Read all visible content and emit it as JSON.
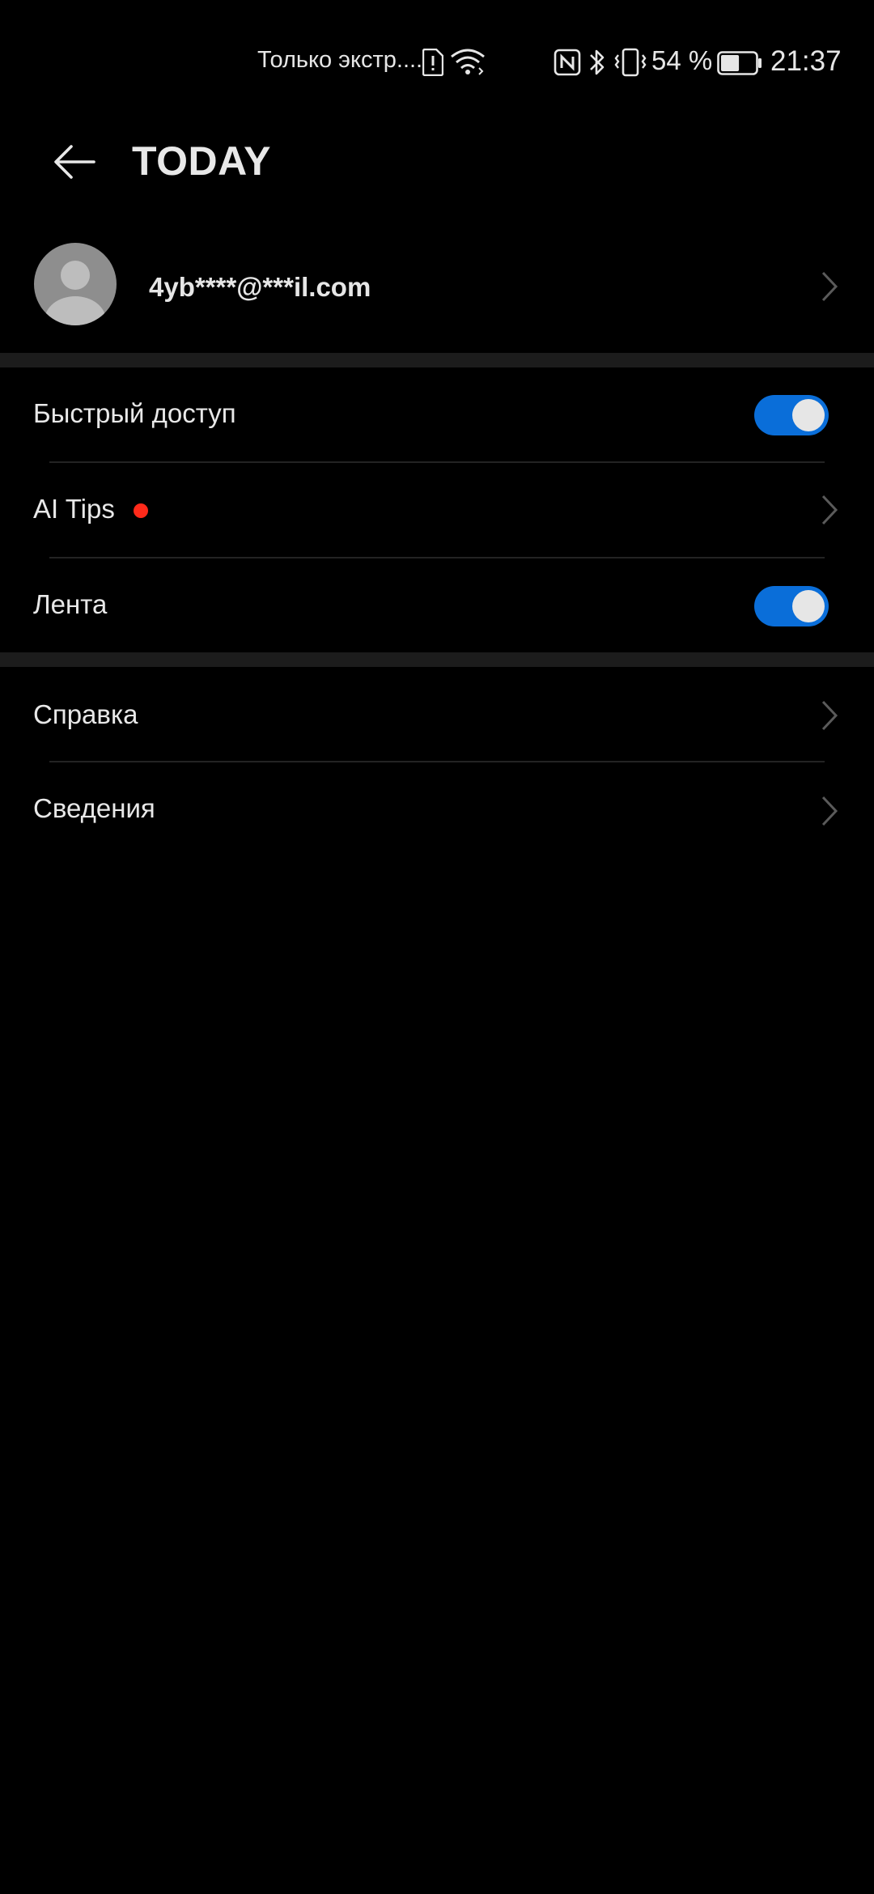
{
  "status_bar": {
    "carrier_text": "Только экстр....",
    "battery_percent": "54 %",
    "time": "21:37",
    "battery_level": 0.54,
    "icons": [
      "sim-alert-icon",
      "wifi-icon",
      "nfc-icon",
      "bluetooth-icon",
      "vibrate-icon",
      "battery-icon"
    ]
  },
  "app_bar": {
    "title": "TODAY"
  },
  "account": {
    "email": "4yb****@***il.com"
  },
  "section1": {
    "items": [
      {
        "label": "Быстрый доступ",
        "type": "toggle",
        "on": true
      },
      {
        "label": "AI Tips",
        "type": "link",
        "badge": "red-dot"
      },
      {
        "label": "Лента",
        "type": "toggle",
        "on": true
      }
    ]
  },
  "section2": {
    "items": [
      {
        "label": "Справка",
        "type": "link"
      },
      {
        "label": "Сведения",
        "type": "link"
      }
    ]
  },
  "colors": {
    "background": "#000000",
    "accent": "#0a6ed9",
    "badge": "#ff2a1a",
    "section_gap": "#1c1c1c"
  }
}
